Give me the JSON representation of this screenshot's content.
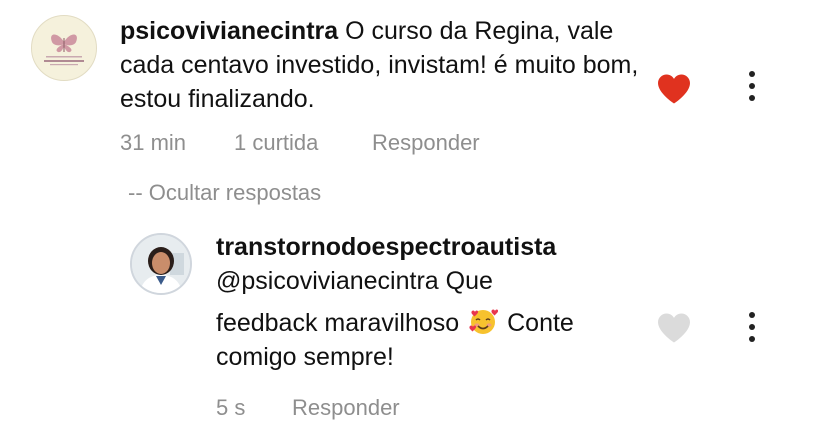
{
  "comment": {
    "username": "psicovivianecintra",
    "text": "O curso da Regina, vale cada centavo investido, invistam! é muito bom, estou finalizando.",
    "time": "31 min",
    "likes": "1 curtida",
    "reply_label": "Responder",
    "liked": true,
    "avatar_logo_text": "Psicóloga Viviane Cintra"
  },
  "hide_replies_label": "-- Ocultar respostas",
  "reply": {
    "username": "transtornodoespectroautista",
    "mention": "@psicovivianecintra",
    "text_start": "Que",
    "text_mid": "feedback maravilhoso",
    "emoji": "smiling-face-with-hearts",
    "text_end": "Conte",
    "text_last": "comigo sempre!",
    "time": "5 s",
    "reply_label": "Responder",
    "liked": false
  },
  "colors": {
    "like_red": "#e0321f",
    "unliked_gray": "#dbdbdb",
    "meta_gray": "#8e8e8e"
  }
}
